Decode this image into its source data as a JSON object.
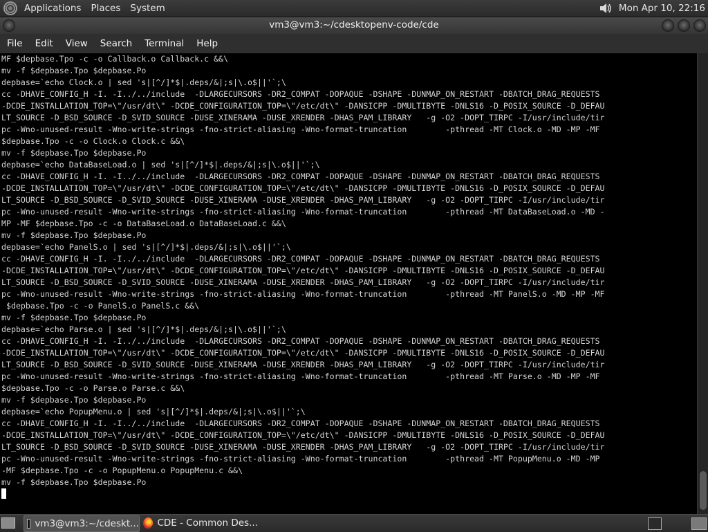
{
  "top_panel": {
    "menus": [
      "Applications",
      "Places",
      "System"
    ],
    "clock": "Mon Apr 10, 22:16"
  },
  "window": {
    "title": "vm3@vm3:~/cdesktopenv-code/cde",
    "menubar": [
      "File",
      "Edit",
      "View",
      "Search",
      "Terminal",
      "Help"
    ]
  },
  "terminal": {
    "lines": [
      "MF $depbase.Tpo -c -o Callback.o Callback.c &&\\",
      "mv -f $depbase.Tpo $depbase.Po",
      "depbase=`echo Clock.o | sed 's|[^/]*$|.deps/&|;s|\\.o$||'`;\\",
      "cc -DHAVE_CONFIG_H -I. -I../../include  -DLARGECURSORS -DR2_COMPAT -DOPAQUE -DSHAPE -DUNMAP_ON_RESTART -DBATCH_DRAG_REQUESTS",
      "-DCDE_INSTALLATION_TOP=\\\"/usr/dt\\\" -DCDE_CONFIGURATION_TOP=\\\"/etc/dt\\\" -DANSICPP -DMULTIBYTE -DNLS16 -D_POSIX_SOURCE -D_DEFAU",
      "LT_SOURCE -D_BSD_SOURCE -D_SVID_SOURCE -DUSE_XINERAMA -DUSE_XRENDER -DHAS_PAM_LIBRARY   -g -O2 -DOPT_TIRPC -I/usr/include/tir",
      "pc -Wno-unused-result -Wno-write-strings -fno-strict-aliasing -Wno-format-truncation        -pthread -MT Clock.o -MD -MP -MF",
      "$depbase.Tpo -c -o Clock.o Clock.c &&\\",
      "mv -f $depbase.Tpo $depbase.Po",
      "depbase=`echo DataBaseLoad.o | sed 's|[^/]*$|.deps/&|;s|\\.o$||'`;\\",
      "cc -DHAVE_CONFIG_H -I. -I../../include  -DLARGECURSORS -DR2_COMPAT -DOPAQUE -DSHAPE -DUNMAP_ON_RESTART -DBATCH_DRAG_REQUESTS",
      "-DCDE_INSTALLATION_TOP=\\\"/usr/dt\\\" -DCDE_CONFIGURATION_TOP=\\\"/etc/dt\\\" -DANSICPP -DMULTIBYTE -DNLS16 -D_POSIX_SOURCE -D_DEFAU",
      "LT_SOURCE -D_BSD_SOURCE -D_SVID_SOURCE -DUSE_XINERAMA -DUSE_XRENDER -DHAS_PAM_LIBRARY   -g -O2 -DOPT_TIRPC -I/usr/include/tir",
      "pc -Wno-unused-result -Wno-write-strings -fno-strict-aliasing -Wno-format-truncation        -pthread -MT DataBaseLoad.o -MD -",
      "MP -MF $depbase.Tpo -c -o DataBaseLoad.o DataBaseLoad.c &&\\",
      "mv -f $depbase.Tpo $depbase.Po",
      "depbase=`echo PanelS.o | sed 's|[^/]*$|.deps/&|;s|\\.o$||'`;\\",
      "cc -DHAVE_CONFIG_H -I. -I../../include  -DLARGECURSORS -DR2_COMPAT -DOPAQUE -DSHAPE -DUNMAP_ON_RESTART -DBATCH_DRAG_REQUESTS",
      "-DCDE_INSTALLATION_TOP=\\\"/usr/dt\\\" -DCDE_CONFIGURATION_TOP=\\\"/etc/dt\\\" -DANSICPP -DMULTIBYTE -DNLS16 -D_POSIX_SOURCE -D_DEFAU",
      "LT_SOURCE -D_BSD_SOURCE -D_SVID_SOURCE -DUSE_XINERAMA -DUSE_XRENDER -DHAS_PAM_LIBRARY   -g -O2 -DOPT_TIRPC -I/usr/include/tir",
      "pc -Wno-unused-result -Wno-write-strings -fno-strict-aliasing -Wno-format-truncation        -pthread -MT PanelS.o -MD -MP -MF",
      " $depbase.Tpo -c -o PanelS.o PanelS.c &&\\",
      "mv -f $depbase.Tpo $depbase.Po",
      "depbase=`echo Parse.o | sed 's|[^/]*$|.deps/&|;s|\\.o$||'`;\\",
      "cc -DHAVE_CONFIG_H -I. -I../../include  -DLARGECURSORS -DR2_COMPAT -DOPAQUE -DSHAPE -DUNMAP_ON_RESTART -DBATCH_DRAG_REQUESTS",
      "-DCDE_INSTALLATION_TOP=\\\"/usr/dt\\\" -DCDE_CONFIGURATION_TOP=\\\"/etc/dt\\\" -DANSICPP -DMULTIBYTE -DNLS16 -D_POSIX_SOURCE -D_DEFAU",
      "LT_SOURCE -D_BSD_SOURCE -D_SVID_SOURCE -DUSE_XINERAMA -DUSE_XRENDER -DHAS_PAM_LIBRARY   -g -O2 -DOPT_TIRPC -I/usr/include/tir",
      "pc -Wno-unused-result -Wno-write-strings -fno-strict-aliasing -Wno-format-truncation        -pthread -MT Parse.o -MD -MP -MF",
      "$depbase.Tpo -c -o Parse.o Parse.c &&\\",
      "mv -f $depbase.Tpo $depbase.Po",
      "depbase=`echo PopupMenu.o | sed 's|[^/]*$|.deps/&|;s|\\.o$||'`;\\",
      "cc -DHAVE_CONFIG_H -I. -I../../include  -DLARGECURSORS -DR2_COMPAT -DOPAQUE -DSHAPE -DUNMAP_ON_RESTART -DBATCH_DRAG_REQUESTS",
      "-DCDE_INSTALLATION_TOP=\\\"/usr/dt\\\" -DCDE_CONFIGURATION_TOP=\\\"/etc/dt\\\" -DANSICPP -DMULTIBYTE -DNLS16 -D_POSIX_SOURCE -D_DEFAU",
      "LT_SOURCE -D_BSD_SOURCE -D_SVID_SOURCE -DUSE_XINERAMA -DUSE_XRENDER -DHAS_PAM_LIBRARY   -g -O2 -DOPT_TIRPC -I/usr/include/tir",
      "pc -Wno-unused-result -Wno-write-strings -fno-strict-aliasing -Wno-format-truncation        -pthread -MT PopupMenu.o -MD -MP",
      "-MF $depbase.Tpo -c -o PopupMenu.o PopupMenu.c &&\\",
      "mv -f $depbase.Tpo $depbase.Po"
    ]
  },
  "taskbar": {
    "tasks": [
      "vm3@vm3:~/cdeskt...",
      "CDE - Common Des..."
    ]
  },
  "colors": {
    "terminal_bg": "#000000",
    "terminal_fg": "#d4d4d4",
    "panel_bg": "#333333"
  }
}
